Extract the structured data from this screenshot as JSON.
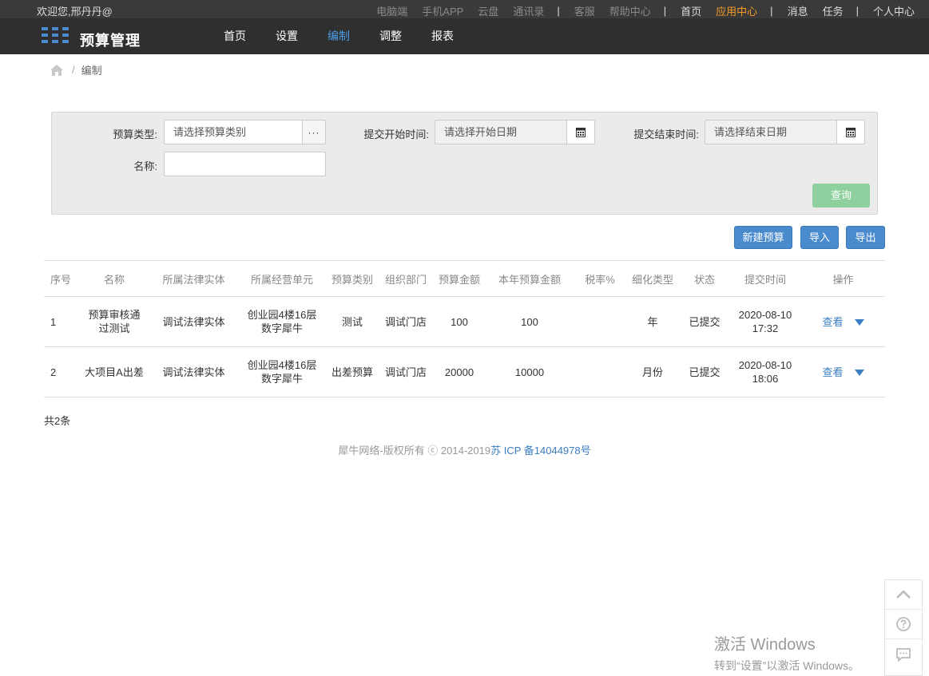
{
  "topbar": {
    "welcome": "欢迎您,邢丹丹@",
    "links_dim": [
      "电脑端",
      "手机APP",
      "云盘",
      "通讯录"
    ],
    "links_mid": [
      "客服",
      "帮助中心"
    ],
    "home": "首页",
    "app_center": "应用中心",
    "messages": "消息",
    "tasks": "任务",
    "personal": "个人中心",
    "separator": "|"
  },
  "header": {
    "title": "预算管理",
    "nav": [
      "首页",
      "设置",
      "编制",
      "调整",
      "报表"
    ],
    "active_nav": "编制"
  },
  "breadcrumb": {
    "sep": "/",
    "current": "编制"
  },
  "filter": {
    "type_label": "预算类型:",
    "type_placeholder": "请选择预算类别",
    "more_btn": "···",
    "start_label": "提交开始时间:",
    "start_placeholder": "请选择开始日期",
    "end_label": "提交结束时间:",
    "end_placeholder": "请选择结束日期",
    "name_label": "名称:",
    "name_value": "",
    "query_btn": "查询"
  },
  "actions": {
    "new": "新建预算",
    "import": "导入",
    "export": "导出"
  },
  "table": {
    "headers": [
      "序号",
      "名称",
      "所属法律实体",
      "所属经营单元",
      "预算类别",
      "组织部门",
      "预算金额",
      "本年预算金额",
      "税率%",
      "细化类型",
      "状态",
      "提交时间",
      "操作"
    ],
    "rows": [
      {
        "no": "1",
        "name_l1": "预算审核通",
        "name_l2": "过测试",
        "entity": "调试法律实体",
        "unit_l1": "创业园4楼16层",
        "unit_l2": "数字犀牛",
        "category": "测试",
        "dept": "调试门店",
        "amount": "100",
        "year_amount": "100",
        "tax": "",
        "detail_type": "年",
        "status": "已提交",
        "date": "2020-08-10",
        "time": "17:32",
        "op": "查看"
      },
      {
        "no": "2",
        "name_l1": "大项目A出差",
        "name_l2": "",
        "entity": "调试法律实体",
        "unit_l1": "创业园4楼16层",
        "unit_l2": "数字犀牛",
        "category": "出差预算",
        "dept": "调试门店",
        "amount": "20000",
        "year_amount": "10000",
        "tax": "",
        "detail_type": "月份",
        "status": "已提交",
        "date": "2020-08-10",
        "time": "18:06",
        "op": "查看"
      }
    ]
  },
  "total": "共2条",
  "footer": {
    "copyright": "犀牛网络-版权所有 ⓒ 2014-2019",
    "icp": "苏 ICP 备14044978号"
  },
  "watermark": {
    "line1": "激活 Windows",
    "line2": "转到“设置”以激活 Windows。"
  },
  "colors": {
    "accent": "#4a8bce",
    "active_nav": "#4a9eea",
    "app_center": "#f59a23",
    "query": "#8fd19e",
    "header_bg": "#2f2f2f"
  }
}
